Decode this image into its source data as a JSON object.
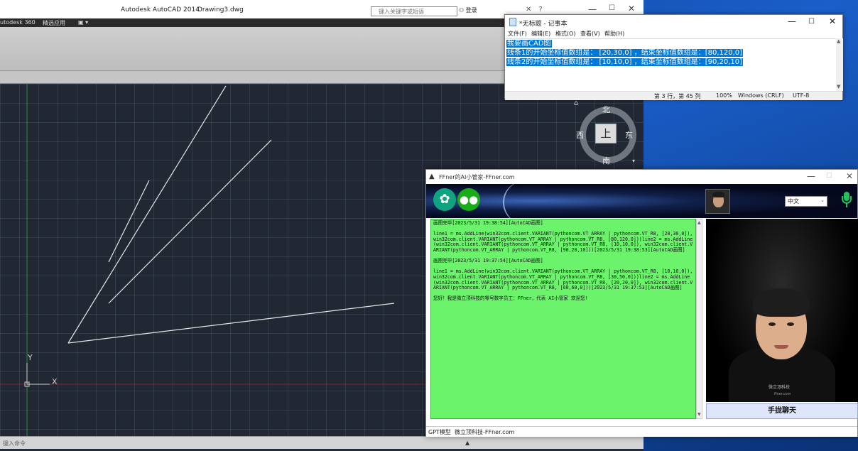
{
  "autocad": {
    "title": "Autodesk AutoCAD 2014",
    "document": "Drawing3.dwg",
    "search_placeholder": "键入关键字或短语",
    "login": "登录",
    "menubar": [
      "utodesk 360",
      "精选应用"
    ],
    "command_placeholder": "键入命令",
    "ucs_y": "Y",
    "ucs_x": "X"
  },
  "viewcube": {
    "north": "北",
    "south": "南",
    "east": "东",
    "west": "西",
    "face": "上"
  },
  "notepad": {
    "title": "*无标题 - 记事本",
    "menu": [
      "文件(F)",
      "编辑(E)",
      "格式(O)",
      "查看(V)",
      "帮助(H)"
    ],
    "lines": [
      "我要画CAD图",
      "线条1的开始坐标值数组是： [20,30,0] ，结束坐标值数组是：[80,120,0]",
      "线条2的开始坐标值数组是： [10,10,0] ，结束坐标值数组是：[90,20,10]"
    ],
    "status": {
      "position": "第 3 行，第 45 列",
      "zoom": "100%",
      "line_ending": "Windows (CRLF)",
      "encoding": "UTF-8"
    }
  },
  "ffner": {
    "title": "FFner的AI小管家-FFner.com",
    "language": "中文",
    "chat_messages": [
      "画图完毕[2023/5/31 19:38:54][AutoCAD画图]",
      "line1 = ms.AddLine(win32com.client.VARIANT(pythoncom.VT_ARRAY | pythoncom.VT_R8, [20,30,0]), win32com.client.VARIANT(pythoncom.VT_ARRAY | pythoncom.VT_R8, [80,120,0]))line2 = ms.AddLine(win32com.client.VARIANT(pythoncom.VT_ARRAY | pythoncom.VT_R8, [10,10,0]), win32com.client.VARIANT(pythoncom.VT_ARRAY | pythoncom.VT_R8, [90,20,10]))[2023/5/31 19:38:53][AutoCAD画图]",
      "画图完毕[2023/5/31 19:37:54][AutoCAD画图]",
      "line1 = ms.AddLine(win32com.client.VARIANT(pythoncom.VT_ARRAY | pythoncom.VT_R8, [10,10,0]), win32com.client.VARIANT(pythoncom.VT_ARRAY | pythoncom.VT_R8, [30,50,0]))line2 = ms.AddLine(win32com.client.VARIANT(pythoncom.VT_ARRAY | pythoncom.VT_R8, [20,20,0]), win32com.client.VARIANT(pythoncom.VT_ARRAY | pythoncom.VT_R8, [60,60,0]))[2023/5/31 19:37:53][AutoCAD画图]",
      "您好！我是微立顶科技的零号数字员工：FFner，代表 AI小管家 欢迎您!"
    ],
    "chat_button": "手拢聊天",
    "avatar_brand": "微立顶科技",
    "avatar_site": "ffner.com",
    "status": {
      "model": "GPT模型",
      "company": "微立顶科技-FFner.com"
    }
  }
}
